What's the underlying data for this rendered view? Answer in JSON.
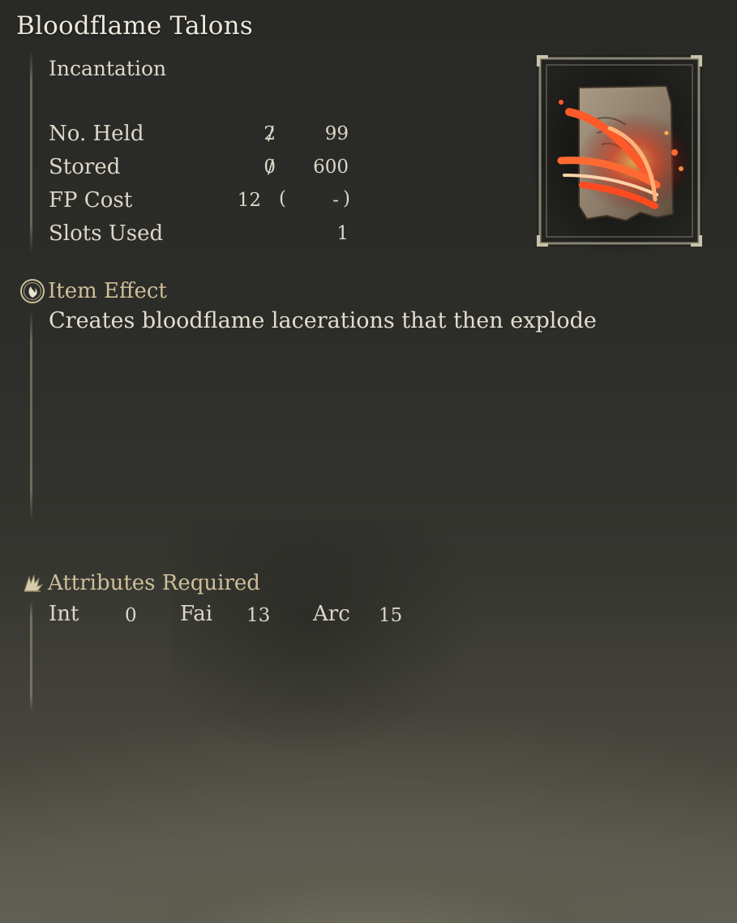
{
  "item": {
    "name": "Bloodflame Talons",
    "category": "Incantation"
  },
  "stats": {
    "held": {
      "label": "No. Held",
      "value": "2",
      "separator": "/",
      "max": "99"
    },
    "stored": {
      "label": "Stored",
      "value": "0",
      "separator": "/",
      "max": "600"
    },
    "fp_cost": {
      "label": "FP Cost",
      "value": "12",
      "paren_open": "(",
      "secondary": "-",
      "paren_close": ")"
    },
    "slots": {
      "label": "Slots Used",
      "value": "1"
    }
  },
  "effect": {
    "heading": "Item Effect",
    "text": "Creates bloodflame lacerations that then explode",
    "icon": "effect-swirl-icon"
  },
  "attributes": {
    "heading": "Attributes Required",
    "icon": "feather-hand-icon",
    "items": [
      {
        "label": "Int",
        "value": "0"
      },
      {
        "label": "Fai",
        "value": "13"
      },
      {
        "label": "Arc",
        "value": "15"
      }
    ]
  },
  "colors": {
    "text": "#dcd7c9",
    "heading_gold": "#cdbf98",
    "flame_red": "#e23a1a"
  }
}
